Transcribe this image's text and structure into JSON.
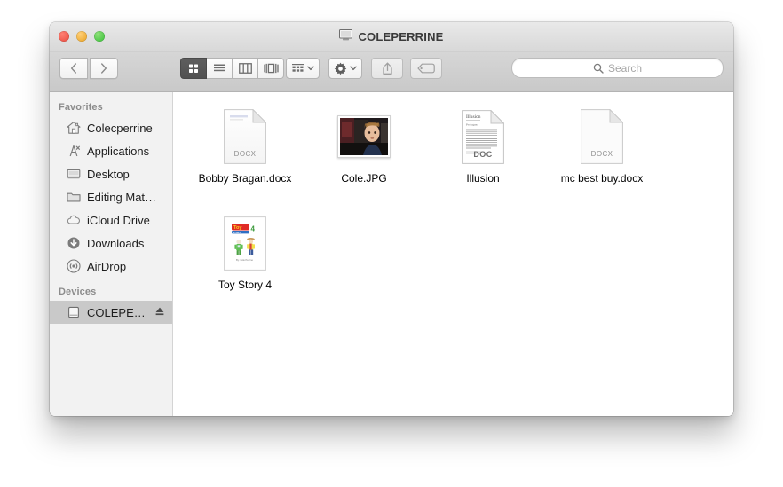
{
  "window": {
    "title": "COLEPERRINE",
    "title_icon": "computer-display-icon",
    "traffic_lights": {
      "close_label": "Close",
      "minimize_label": "Minimize",
      "zoom_label": "Zoom",
      "close_color": "#e8483c",
      "minimize_color": "#e8a01e",
      "zoom_color": "#35bf35"
    }
  },
  "toolbar": {
    "back_label": "Back",
    "back_icon": "chevron-left-icon",
    "forward_label": "Forward",
    "forward_icon": "chevron-right-icon",
    "views": [
      {
        "label": "Icon View",
        "icon": "icon-view-icon",
        "active": true
      },
      {
        "label": "List View",
        "icon": "list-view-icon",
        "active": false
      },
      {
        "label": "Column View",
        "icon": "column-view-icon",
        "active": false
      },
      {
        "label": "Cover Flow View",
        "icon": "coverflow-view-icon",
        "active": false
      }
    ],
    "arrange_label": "Arrange",
    "arrange_icon": "arrange-grid-icon",
    "action_label": "Action",
    "action_icon": "gear-icon",
    "share_label": "Share",
    "share_icon": "share-icon",
    "tags_label": "Tags",
    "tags_icon": "tag-icon",
    "dropdown_icon": "chevron-down-icon"
  },
  "search": {
    "icon": "search-icon",
    "placeholder": "Search",
    "value": ""
  },
  "sidebar": {
    "sections": [
      {
        "header": "Favorites",
        "items": [
          {
            "label": "Colecperrine",
            "icon": "home-icon",
            "selected": false
          },
          {
            "label": "Applications",
            "icon": "applications-icon",
            "selected": false
          },
          {
            "label": "Desktop",
            "icon": "desktop-icon",
            "selected": false
          },
          {
            "label": "Editing Mat…",
            "icon": "folder-icon",
            "selected": false
          },
          {
            "label": "iCloud Drive",
            "icon": "cloud-icon",
            "selected": false
          },
          {
            "label": "Downloads",
            "icon": "download-icon",
            "selected": false
          },
          {
            "label": "AirDrop",
            "icon": "airdrop-icon",
            "selected": false
          }
        ]
      },
      {
        "header": "Devices",
        "items": [
          {
            "label": "COLEPE…",
            "icon": "hard-drive-icon",
            "selected": true,
            "eject_icon": "eject-icon"
          }
        ]
      }
    ]
  },
  "files": [
    {
      "name": "Bobby Bragan.docx",
      "kind": "doc-sheet",
      "ext_label": "DOCX"
    },
    {
      "name": "Cole.JPG",
      "kind": "photo",
      "ext_label": ""
    },
    {
      "name": "Illusion",
      "kind": "doc-preview",
      "ext_label": "DOC"
    },
    {
      "name": "mc best buy.docx",
      "kind": "doc-sheet",
      "ext_label": "DOCX"
    },
    {
      "name": "Toy Story 4",
      "kind": "toystory-preview",
      "ext_label": ""
    }
  ]
}
